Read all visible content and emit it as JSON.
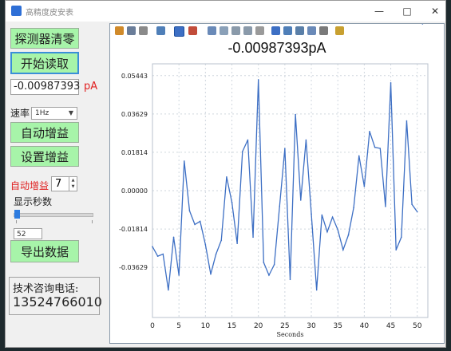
{
  "window": {
    "title": "高精度皮安表"
  },
  "left": {
    "zero_button": "探测器清零",
    "start_read_button": "开始读取",
    "reading_value": "-0.00987393",
    "reading_unit": "pA",
    "rate_label": "速率",
    "rate_value": "1Hz",
    "auto_gain_button": "自动增益",
    "set_gain_button": "设置增益",
    "auto_gain_label": "自动增益",
    "auto_gain_value": "7",
    "display_seconds_label": "显示秒数",
    "seconds_value": "52",
    "export_button": "导出数据",
    "contact_label": "技术咨询电话:",
    "contact_phone": "13524766010"
  },
  "chart_data": {
    "type": "line",
    "title": "-0.00987393pA",
    "xlabel": "Seconds",
    "ylabel": "",
    "xlim": [
      0,
      52
    ],
    "ylim": [
      -0.06,
      0.06
    ],
    "xticks": [
      0,
      5,
      10,
      15,
      20,
      25,
      30,
      35,
      40,
      45,
      50
    ],
    "yticks": [
      -0.03629,
      -0.01814,
      0.0,
      0.01814,
      0.03629,
      0.05443
    ],
    "ytick_labels": [
      "-0.03629",
      "-0.01814",
      "0.00000",
      "0.01814",
      "0.03629",
      "0.05443"
    ],
    "color": "#3d6fc4",
    "x": [
      0,
      1,
      2,
      3,
      4,
      5,
      6,
      7,
      8,
      9,
      10,
      11,
      12,
      13,
      14,
      15,
      16,
      17,
      18,
      19,
      20,
      21,
      22,
      23,
      24,
      25,
      26,
      27,
      28,
      29,
      30,
      31,
      32,
      33,
      34,
      35,
      36,
      37,
      38,
      39,
      40,
      41,
      42,
      43,
      44,
      45,
      46,
      47,
      48,
      49,
      50,
      51
    ],
    "y": [
      -0.0265,
      -0.031,
      -0.03,
      -0.047,
      -0.022,
      -0.04,
      0.014,
      -0.0095,
      -0.016,
      -0.0145,
      -0.0255,
      -0.0395,
      -0.03,
      -0.0235,
      0.0065,
      -0.0055,
      -0.025,
      0.0185,
      0.024,
      -0.022,
      0.0525,
      -0.034,
      -0.04,
      -0.035,
      -0.0075,
      0.02,
      -0.042,
      0.036,
      -0.0045,
      0.024,
      -0.011,
      -0.047,
      -0.0115,
      -0.0195,
      -0.0125,
      -0.0185,
      -0.028,
      -0.021,
      -0.008,
      0.0165,
      0.002,
      0.028,
      0.0205,
      0.02,
      -0.0075,
      0.051,
      -0.028,
      -0.022,
      0.033,
      -0.0065,
      -0.01
    ]
  }
}
